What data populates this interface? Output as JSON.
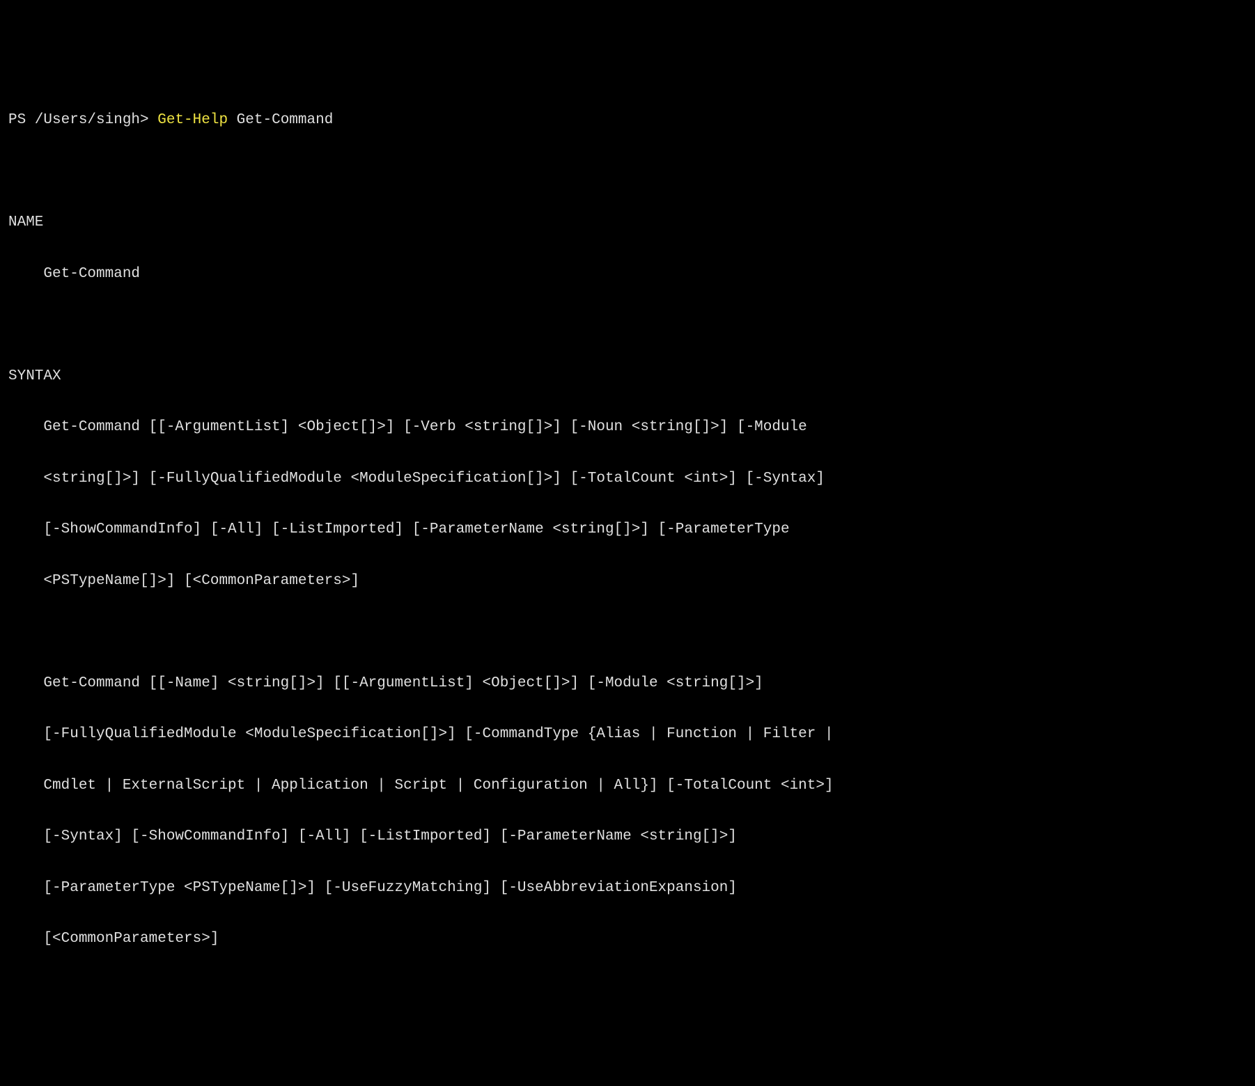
{
  "prompt": {
    "prefix": "PS /Users/singh> ",
    "command": "Get-Help",
    "argument": " Get-Command"
  },
  "help": {
    "name_header": "NAME",
    "name_value": "Get-Command",
    "syntax_header": "SYNTAX",
    "syntax1_line1": "Get-Command [[-ArgumentList] <Object[]>] [-Verb <string[]>] [-Noun <string[]>] [-Module ",
    "syntax1_line2": "<string[]>] [-FullyQualifiedModule <ModuleSpecification[]>] [-TotalCount <int>] [-Syntax] ",
    "syntax1_line3": "[-ShowCommandInfo] [-All] [-ListImported] [-ParameterName <string[]>] [-ParameterType ",
    "syntax1_line4": "<PSTypeName[]>] [<CommonParameters>]",
    "syntax2_line1": "Get-Command [[-Name] <string[]>] [[-ArgumentList] <Object[]>] [-Module <string[]>] ",
    "syntax2_line2": "[-FullyQualifiedModule <ModuleSpecification[]>] [-CommandType {Alias | Function | Filter | ",
    "syntax2_line3": "Cmdlet | ExternalScript | Application | Script | Configuration | All}] [-TotalCount <int>] ",
    "syntax2_line4": "[-Syntax] [-ShowCommandInfo] [-All] [-ListImported] [-ParameterName <string[]>] ",
    "syntax2_line5": "[-ParameterType <PSTypeName[]>] [-UseFuzzyMatching] [-UseAbbreviationExpansion] ",
    "syntax2_line6": "[<CommonParameters>]"
  }
}
